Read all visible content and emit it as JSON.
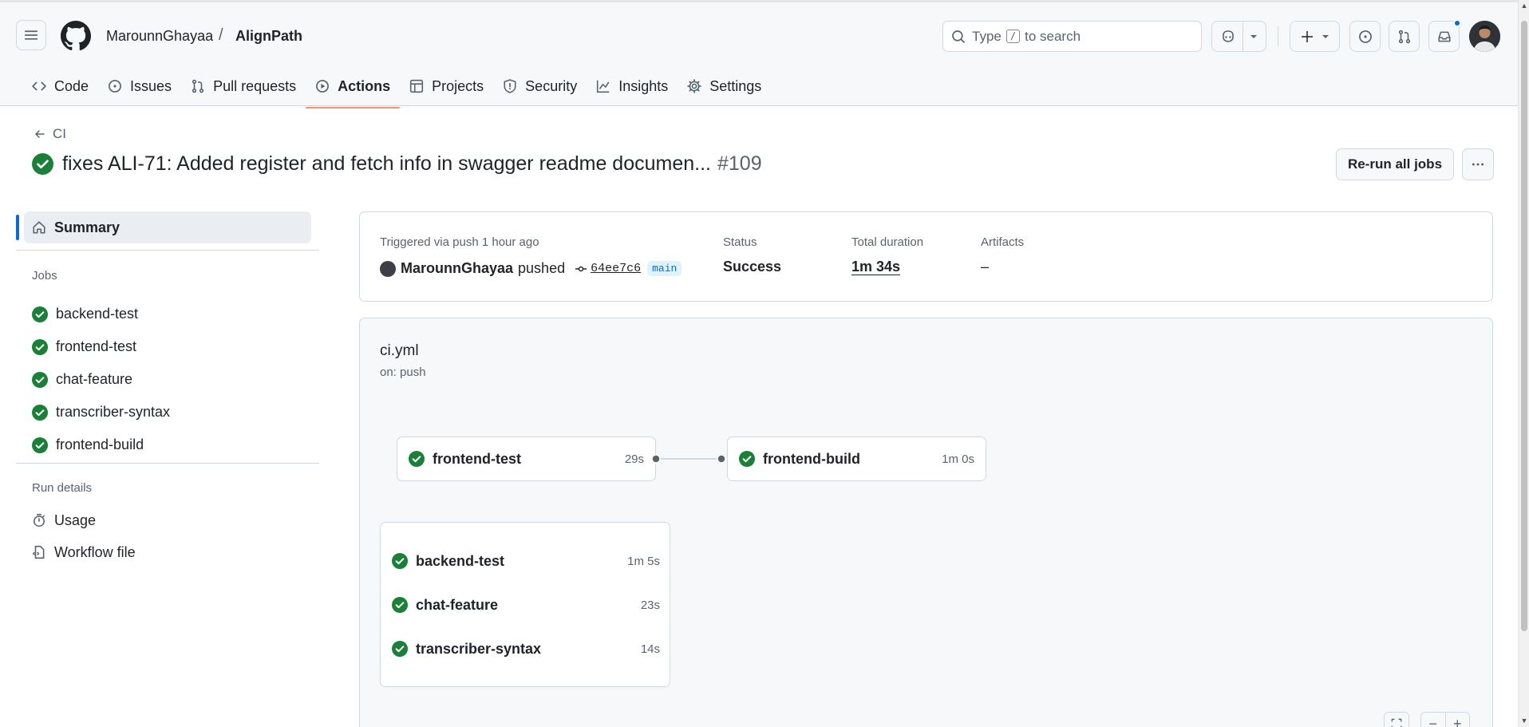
{
  "header": {
    "owner": "MarounnGhayaa",
    "separator": "/",
    "repo": "AlignPath",
    "search_prefix": "Type",
    "search_key": "/",
    "search_suffix": "to search"
  },
  "reponav": {
    "items": [
      {
        "label": "Code",
        "icon": "code-icon"
      },
      {
        "label": "Issues",
        "icon": "issue-icon"
      },
      {
        "label": "Pull requests",
        "icon": "pull-request-icon"
      },
      {
        "label": "Actions",
        "icon": "play-icon",
        "active": true
      },
      {
        "label": "Projects",
        "icon": "table-icon"
      },
      {
        "label": "Security",
        "icon": "shield-icon"
      },
      {
        "label": "Insights",
        "icon": "graph-icon"
      },
      {
        "label": "Settings",
        "icon": "gear-icon"
      }
    ]
  },
  "run": {
    "back_label": "CI",
    "title": "fixes ALI-71: Added register and fetch info in swagger readme documen...",
    "number": "#109",
    "rerun_label": "Re-run all jobs"
  },
  "sidebar": {
    "summary_label": "Summary",
    "jobs_heading": "Jobs",
    "jobs": [
      "backend-test",
      "frontend-test",
      "chat-feature",
      "transcriber-syntax",
      "frontend-build"
    ],
    "details_heading": "Run details",
    "details": [
      {
        "label": "Usage",
        "icon": "stopwatch-icon"
      },
      {
        "label": "Workflow file",
        "icon": "file-code-icon"
      }
    ]
  },
  "summary_card": {
    "triggered_label": "Triggered via push 1 hour ago",
    "user": "MarounnGhayaa",
    "action": "pushed",
    "sha": "64ee7c6",
    "branch": "main",
    "status_label": "Status",
    "status_value": "Success",
    "duration_label": "Total duration",
    "duration_value": "1m 34s",
    "artifacts_label": "Artifacts",
    "artifacts_value": "–"
  },
  "workflow": {
    "file": "ci.yml",
    "trigger": "on: push",
    "chain": [
      {
        "name": "frontend-test",
        "time": "29s"
      },
      {
        "name": "frontend-build",
        "time": "1m 0s"
      }
    ],
    "group": [
      {
        "name": "backend-test",
        "time": "1m 5s"
      },
      {
        "name": "chat-feature",
        "time": "23s"
      },
      {
        "name": "transcriber-syntax",
        "time": "14s"
      }
    ]
  },
  "colors": {
    "success": "#1a7f37",
    "accent": "#0969da",
    "active_underline": "#fd8c73"
  }
}
